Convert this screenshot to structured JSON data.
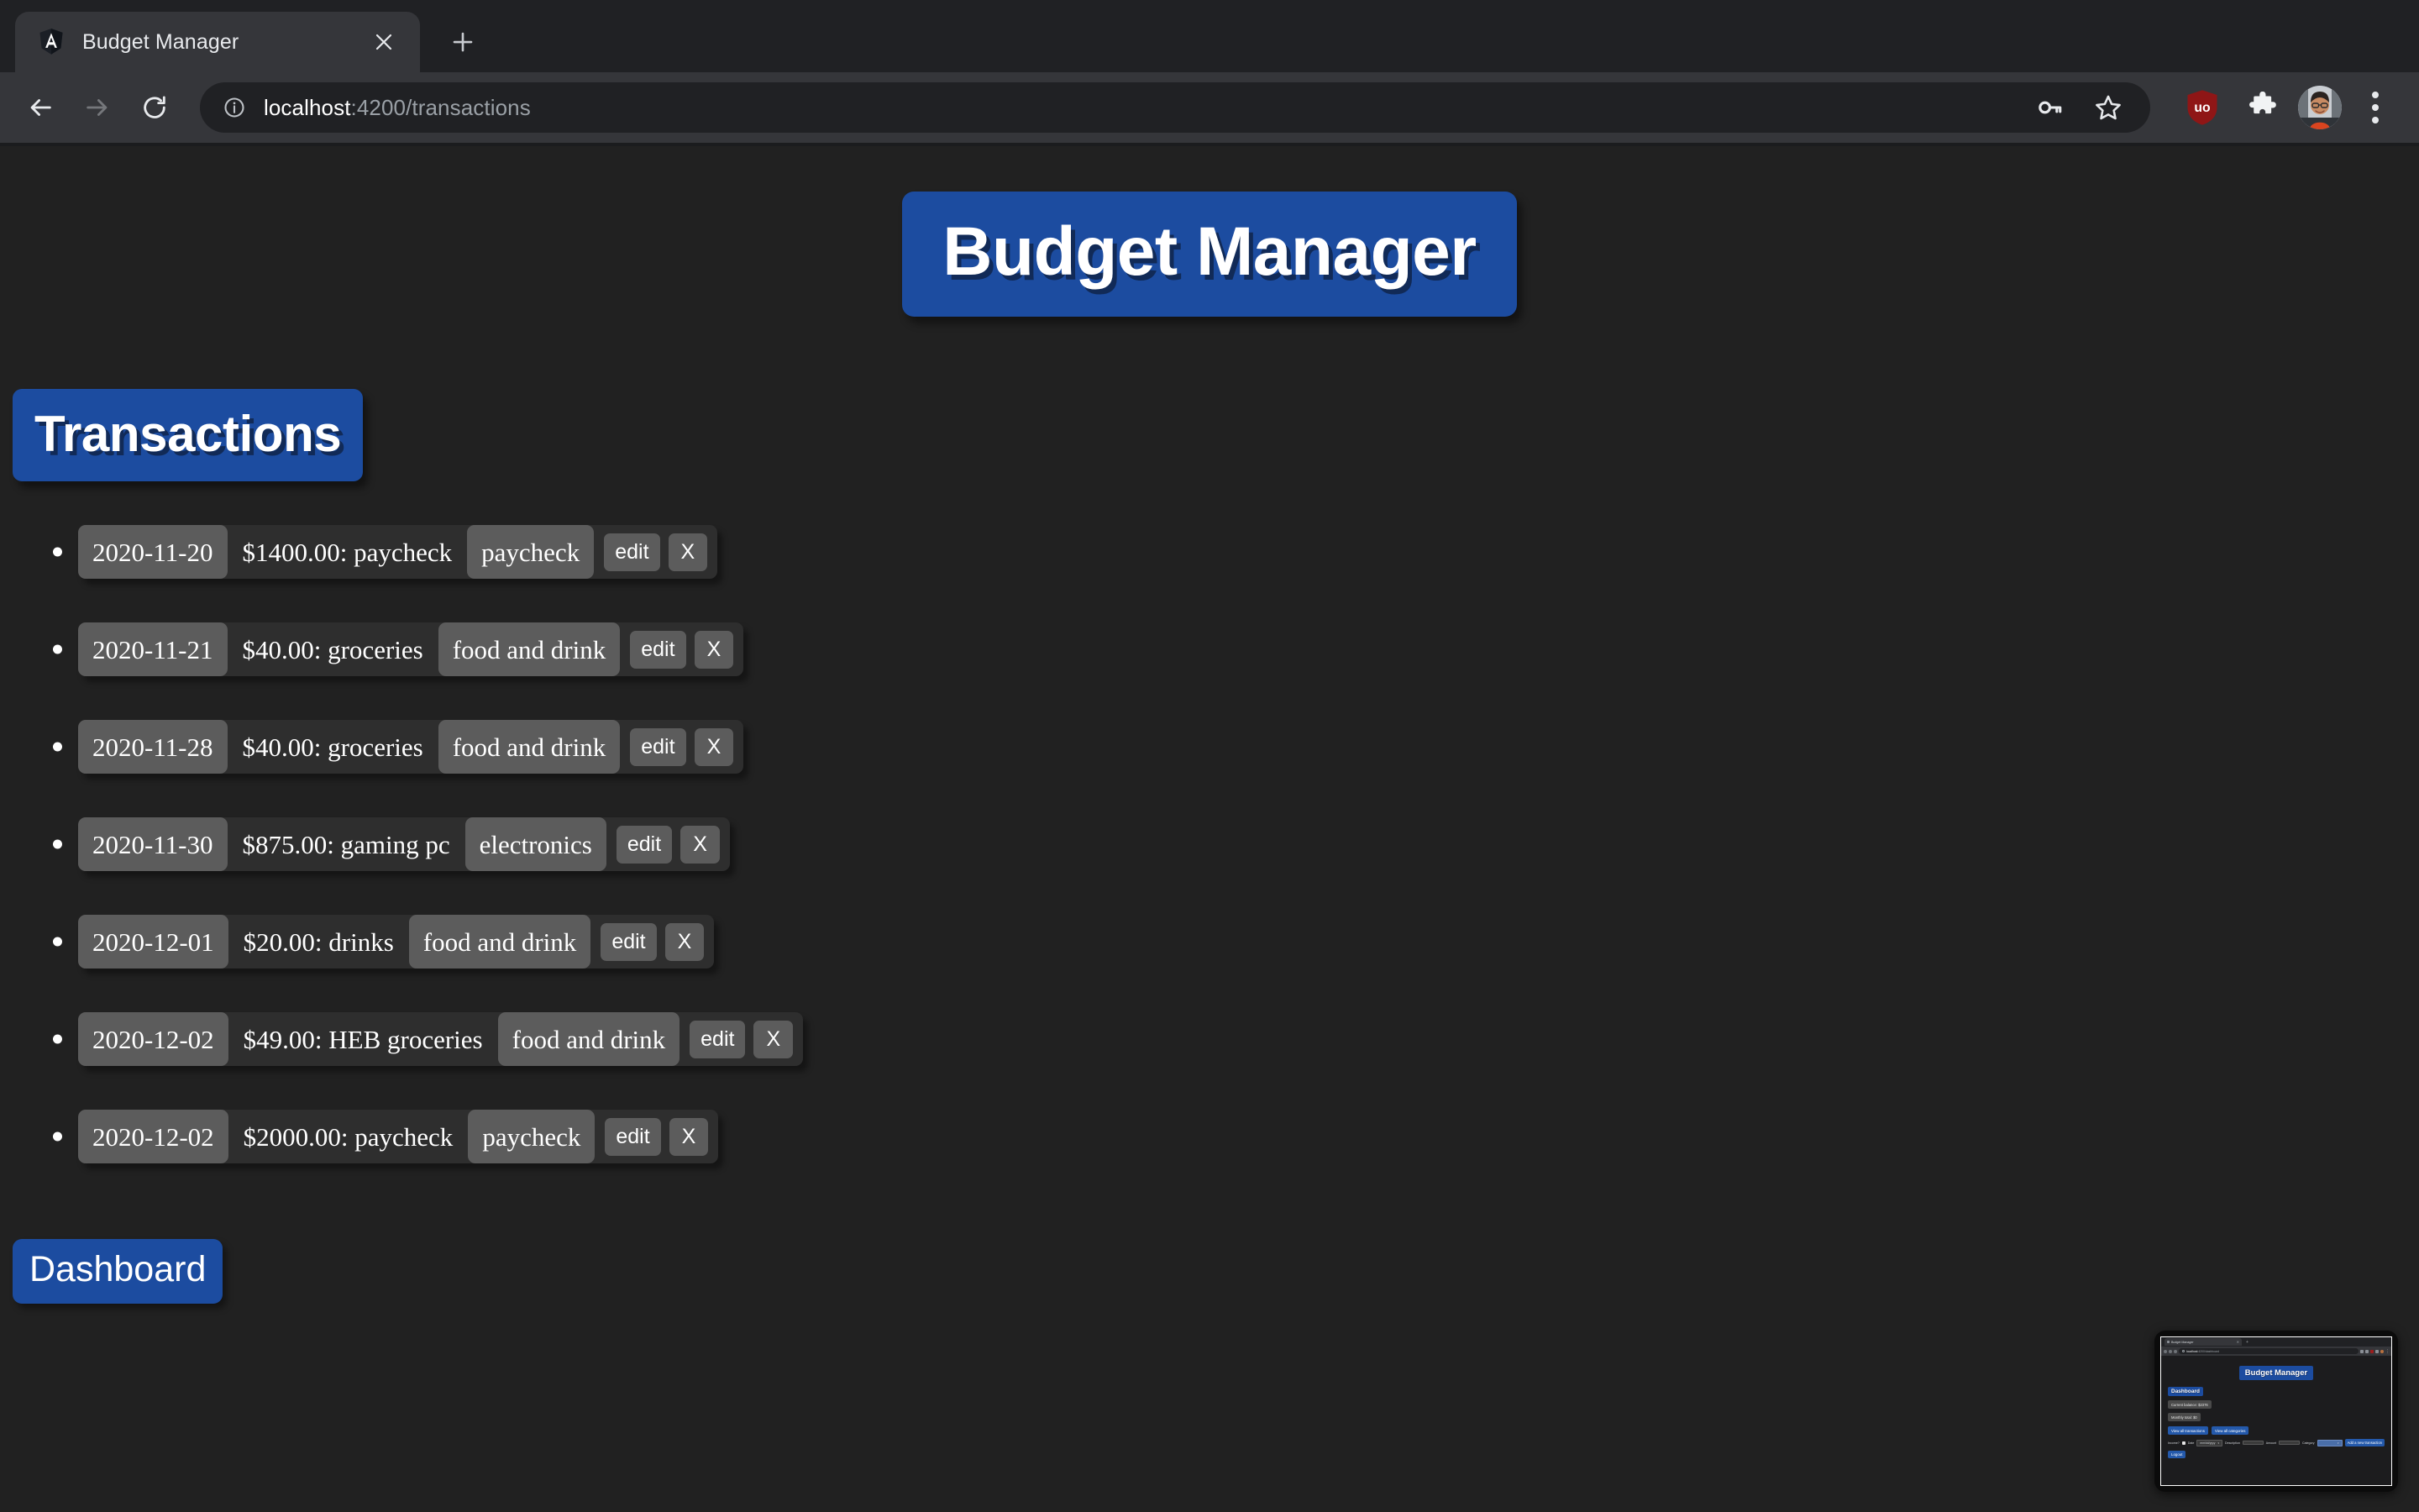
{
  "browser": {
    "tab": {
      "title": "Budget Manager",
      "favicon_icon": "angular-shield-icon",
      "close_label": "✕"
    },
    "newtab_label": "+",
    "nav": {
      "back_icon": "arrow-left-icon",
      "forward_icon": "arrow-right-icon",
      "reload_icon": "reload-icon"
    },
    "omnibox": {
      "info_icon": "site-info-icon",
      "host": "localhost",
      "path": ":4200/transactions",
      "full_url": "localhost:4200/transactions",
      "key_icon": "password-key-icon",
      "star_icon": "bookmark-star-icon"
    },
    "extensions": {
      "ublock_icon": "ublock-origin-shield-icon",
      "ublock_label": "uo",
      "puzzle_icon": "extensions-puzzle-icon",
      "avatar_icon": "profile-avatar-icon",
      "menu_icon": "three-dot-menu-icon"
    }
  },
  "page": {
    "app_title": "Budget Manager",
    "section_title": "Transactions",
    "dashboard_button": "Dashboard",
    "accent_color": "#1c4ca0",
    "background_color": "#212121",
    "chip_color": "#5c5c5c",
    "row_color": "#2e2e2e",
    "action_labels": {
      "edit": "edit",
      "delete": "X"
    },
    "transactions": [
      {
        "date": "2020-11-20",
        "description": "$1400.00: paycheck",
        "category": "paycheck",
        "edit": "edit",
        "delete": "X"
      },
      {
        "date": "2020-11-21",
        "description": "$40.00: groceries",
        "category": "food and drink",
        "edit": "edit",
        "delete": "X"
      },
      {
        "date": "2020-11-28",
        "description": "$40.00: groceries",
        "category": "food and drink",
        "edit": "edit",
        "delete": "X"
      },
      {
        "date": "2020-11-30",
        "description": "$875.00: gaming pc",
        "category": "electronics",
        "edit": "edit",
        "delete": "X"
      },
      {
        "date": "2020-12-01",
        "description": "$20.00: drinks",
        "category": "food and drink",
        "edit": "edit",
        "delete": "X"
      },
      {
        "date": "2020-12-02",
        "description": "$49.00: HEB groceries",
        "category": "food and drink",
        "edit": "edit",
        "delete": "X"
      },
      {
        "date": "2020-12-02",
        "description": "$2000.00: paycheck",
        "category": "paycheck",
        "edit": "edit",
        "delete": "X"
      }
    ]
  },
  "thumbnail": {
    "tab_title": "Budget Manager",
    "url_host": "localhost",
    "url_path": ":4200/dashboard",
    "app_title": "Budget Manager",
    "heading": "Dashboard",
    "balance_chip": "Current balance: $2376",
    "monthly_chip": "Monthly total: $0",
    "view_transactions": "View all transactions",
    "view_categories": "View all categories",
    "form": {
      "income_label": "Income?",
      "date_label": "Date",
      "date_value": "mm/dd/yyyy",
      "description_label": "Description",
      "amount_label": "Amount",
      "category_label": "Category",
      "add_button": "Add a new transaction"
    },
    "logout": "Logout"
  }
}
